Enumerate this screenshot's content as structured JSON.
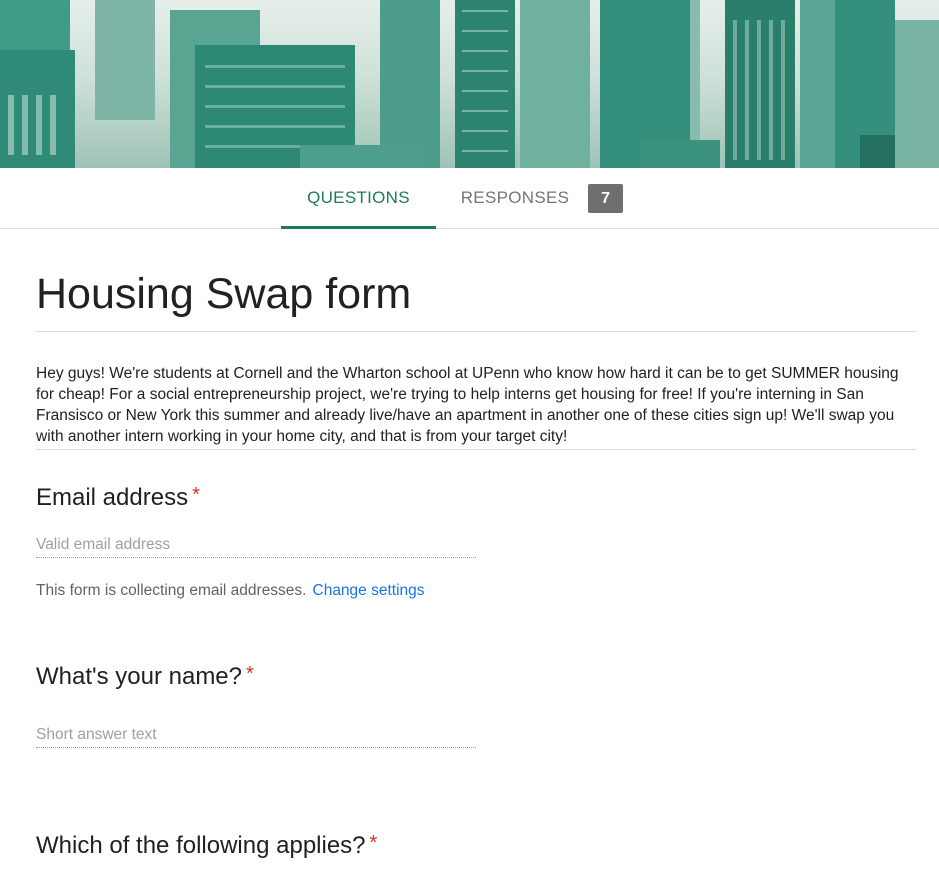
{
  "tabs": {
    "questions_label": "QUESTIONS",
    "responses_label": "RESPONSES",
    "responses_count": "7"
  },
  "form": {
    "title": "Housing Swap form",
    "description": "Hey guys! We're students at Cornell and the Wharton school at UPenn who know how hard it can be to get SUMMER housing for cheap! For a social entrepreneurship project, we're trying to help interns get housing for free! If you're interning in San Fransisco or New York this summer and already live/have an apartment in another one of these cities sign up! We'll swap you with another intern working in your home city, and that is from your target city!"
  },
  "questions": {
    "email": {
      "label": "Email address",
      "required_mark": "*",
      "placeholder": "Valid email address",
      "note": "This form is collecting email addresses.",
      "change_settings": "Change settings"
    },
    "name": {
      "label": "What's your name?",
      "required_mark": "*",
      "placeholder": "Short answer text"
    },
    "applies": {
      "label": "Which of the following applies?",
      "required_mark": "*"
    }
  },
  "colors": {
    "accent": "#1e7a5f",
    "required": "#d93025",
    "link": "#1a73e8",
    "badge": "#6f6f6f"
  },
  "icons": {
    "banner": "city-skyline-illustration"
  }
}
